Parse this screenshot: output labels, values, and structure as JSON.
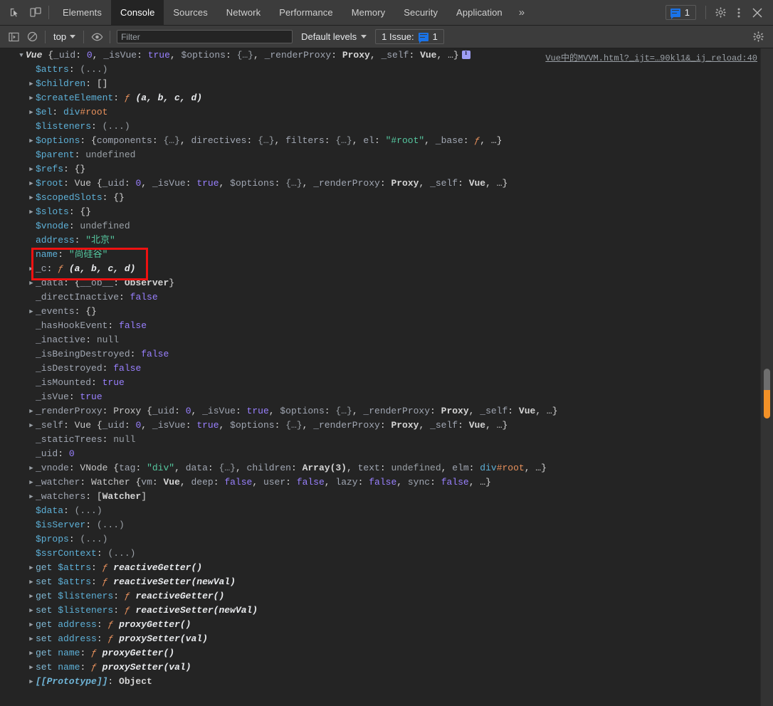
{
  "window": {
    "title": "Chrome DevTools - Console"
  },
  "tabbar": {
    "inspect_icon": "inspect-cursor-icon",
    "device_icon": "device-toggle-icon",
    "tabs": [
      {
        "label": "Elements",
        "active": false
      },
      {
        "label": "Console",
        "active": true
      },
      {
        "label": "Sources",
        "active": false
      },
      {
        "label": "Network",
        "active": false
      },
      {
        "label": "Performance",
        "active": false
      },
      {
        "label": "Memory",
        "active": false
      },
      {
        "label": "Security",
        "active": false
      },
      {
        "label": "Application",
        "active": false
      }
    ],
    "more_label": "»",
    "issue_count": "1",
    "settings_icon": "gear-icon",
    "menu_icon": "kebab-menu-icon",
    "close_icon": "close-icon"
  },
  "filterbar": {
    "sidebar_icon": "show-console-sidebar-icon",
    "clear_icon": "clear-console-icon",
    "context_label": "top",
    "eye_icon": "live-expression-icon",
    "filter_placeholder": "Filter",
    "filter_value": "",
    "levels_label": "Default levels",
    "issues_label": "1 Issue:",
    "issues_count": "1",
    "settings_icon": "console-settings-gear-icon"
  },
  "console": {
    "source_link": "Vue中的MVVM.html?_ijt=…90kl1&_ij_reload:40",
    "annotation": {
      "type": "red-rectangle-highlight",
      "color": "#ee1111",
      "highlighted_rows": [
        "address: \"北京\"",
        "name: \"尚硅谷\""
      ]
    },
    "rows": [
      {
        "arrow": "down",
        "indent": 0,
        "html": "<span class=\"v-ctor\">Vue</span> <span class=\"v-obj\">{</span><span class=\"k-int\">_uid</span><span class=\"v-obj\">: </span><span class=\"v-num\">0</span><span class=\"v-obj\">, </span><span class=\"k-int\">_isVue</span><span class=\"v-obj\">: </span><span class=\"v-bool\">true</span><span class=\"v-obj\">, </span><span class=\"k-int\">$options</span><span class=\"v-obj\">: </span><span class=\"v-dim\">{…}</span><span class=\"v-obj\">, </span><span class=\"k-int\">_renderProxy</span><span class=\"v-obj\">: </span><span class=\"v-bold\">Proxy</span><span class=\"v-obj\">, </span><span class=\"k-int\">_self</span><span class=\"v-obj\">: </span><span class=\"v-bold\">Vue</span><span class=\"v-obj\">, …}</span><span class=\"infoicon\"></span>"
      },
      {
        "arrow": "none",
        "indent": 1,
        "html": "<span class=\"k-name\">$attrs</span><span class=\"v-obj\">: </span><span class=\"v-dim\">(...)</span>"
      },
      {
        "arrow": "right",
        "indent": 1,
        "html": "<span class=\"k-name\">$children</span><span class=\"v-obj\">: </span><span class=\"v-obj\">[]</span>"
      },
      {
        "arrow": "right",
        "indent": 1,
        "html": "<span class=\"k-name\">$createElement</span><span class=\"v-obj\">: </span><span class=\"fnsym\">ƒ</span> <span class=\"v-fn\">(a, b, c, d)</span>"
      },
      {
        "arrow": "right",
        "indent": 1,
        "html": "<span class=\"k-name\">$el</span><span class=\"v-obj\">: </span><span class=\"v-tag\">div</span><span class=\"v-id\">#root</span>"
      },
      {
        "arrow": "none",
        "indent": 1,
        "html": "<span class=\"k-name\">$listeners</span><span class=\"v-obj\">: </span><span class=\"v-dim\">(...)</span>"
      },
      {
        "arrow": "right",
        "indent": 1,
        "html": "<span class=\"k-name\">$options</span><span class=\"v-obj\">: {</span><span class=\"v-prop\">components</span><span class=\"v-obj\">: </span><span class=\"v-dim\">{…}</span><span class=\"v-obj\">, </span><span class=\"v-prop\">directives</span><span class=\"v-obj\">: </span><span class=\"v-dim\">{…}</span><span class=\"v-obj\">, </span><span class=\"v-prop\">filters</span><span class=\"v-obj\">: </span><span class=\"v-dim\">{…}</span><span class=\"v-obj\">, </span><span class=\"v-prop\">el</span><span class=\"v-obj\">: </span><span class=\"v-str\">\"#root\"</span><span class=\"v-obj\">, </span><span class=\"v-prop\">_base</span><span class=\"v-obj\">: </span><span class=\"fnsym\">ƒ</span><span class=\"v-obj\">, …}</span>"
      },
      {
        "arrow": "none",
        "indent": 1,
        "html": "<span class=\"k-name\">$parent</span><span class=\"v-obj\">: </span><span class=\"v-null\">undefined</span>"
      },
      {
        "arrow": "right",
        "indent": 1,
        "html": "<span class=\"k-name\">$refs</span><span class=\"v-obj\">: {}</span>"
      },
      {
        "arrow": "right",
        "indent": 1,
        "html": "<span class=\"k-name\">$root</span><span class=\"v-obj\">: </span><span class=\"v-ctor2\">Vue</span> <span class=\"v-obj\">{</span><span class=\"k-int\">_uid</span><span class=\"v-obj\">: </span><span class=\"v-num\">0</span><span class=\"v-obj\">, </span><span class=\"k-int\">_isVue</span><span class=\"v-obj\">: </span><span class=\"v-bool\">true</span><span class=\"v-obj\">, </span><span class=\"k-int\">$options</span><span class=\"v-obj\">: </span><span class=\"v-dim\">{…}</span><span class=\"v-obj\">, </span><span class=\"k-int\">_renderProxy</span><span class=\"v-obj\">: </span><span class=\"v-bold\">Proxy</span><span class=\"v-obj\">, </span><span class=\"k-int\">_self</span><span class=\"v-obj\">: </span><span class=\"v-bold\">Vue</span><span class=\"v-obj\">, …}</span>"
      },
      {
        "arrow": "right",
        "indent": 1,
        "html": "<span class=\"k-name\">$scopedSlots</span><span class=\"v-obj\">: {}</span>"
      },
      {
        "arrow": "right",
        "indent": 1,
        "html": "<span class=\"k-name\">$slots</span><span class=\"v-obj\">: {}</span>"
      },
      {
        "arrow": "none",
        "indent": 1,
        "html": "<span class=\"k-name\">$vnode</span><span class=\"v-obj\">: </span><span class=\"v-null\">undefined</span>"
      },
      {
        "arrow": "none",
        "indent": 1,
        "html": "<span class=\"k-name\">address</span><span class=\"v-obj\">: </span><span class=\"v-str\">\"北京\"</span>"
      },
      {
        "arrow": "none",
        "indent": 1,
        "html": "<span class=\"k-name\">name</span><span class=\"v-obj\">: </span><span class=\"v-str\">\"尚硅谷\"</span>"
      },
      {
        "arrow": "right",
        "indent": 1,
        "html": "<span class=\"k-int\">_c</span><span class=\"v-obj\">: </span><span class=\"fnsym\">ƒ</span> <span class=\"v-fn\">(a, b, c, d)</span>"
      },
      {
        "arrow": "right",
        "indent": 1,
        "html": "<span class=\"k-int\">_data</span><span class=\"v-obj\">: {</span><span class=\"v-prop\">__ob__</span><span class=\"v-obj\">: </span><span class=\"v-bold\">Observer</span><span class=\"v-obj\">}</span>"
      },
      {
        "arrow": "none",
        "indent": 1,
        "html": "<span class=\"k-int\">_directInactive</span><span class=\"v-obj\">: </span><span class=\"v-bool\">false</span>"
      },
      {
        "arrow": "right",
        "indent": 1,
        "html": "<span class=\"k-int\">_events</span><span class=\"v-obj\">: {}</span>"
      },
      {
        "arrow": "none",
        "indent": 1,
        "html": "<span class=\"k-int\">_hasHookEvent</span><span class=\"v-obj\">: </span><span class=\"v-bool\">false</span>"
      },
      {
        "arrow": "none",
        "indent": 1,
        "html": "<span class=\"k-int\">_inactive</span><span class=\"v-obj\">: </span><span class=\"v-null\">null</span>"
      },
      {
        "arrow": "none",
        "indent": 1,
        "html": "<span class=\"k-int\">_isBeingDestroyed</span><span class=\"v-obj\">: </span><span class=\"v-bool\">false</span>"
      },
      {
        "arrow": "none",
        "indent": 1,
        "html": "<span class=\"k-int\">_isDestroyed</span><span class=\"v-obj\">: </span><span class=\"v-bool\">false</span>"
      },
      {
        "arrow": "none",
        "indent": 1,
        "html": "<span class=\"k-int\">_isMounted</span><span class=\"v-obj\">: </span><span class=\"v-bool\">true</span>"
      },
      {
        "arrow": "none",
        "indent": 1,
        "html": "<span class=\"k-int\">_isVue</span><span class=\"v-obj\">: </span><span class=\"v-bool\">true</span>"
      },
      {
        "arrow": "right",
        "indent": 1,
        "html": "<span class=\"k-int\">_renderProxy</span><span class=\"v-obj\">: </span><span class=\"v-ctor2\">Proxy</span> <span class=\"v-obj\">{</span><span class=\"k-int\">_uid</span><span class=\"v-obj\">: </span><span class=\"v-num\">0</span><span class=\"v-obj\">, </span><span class=\"k-int\">_isVue</span><span class=\"v-obj\">: </span><span class=\"v-bool\">true</span><span class=\"v-obj\">, </span><span class=\"k-int\">$options</span><span class=\"v-obj\">: </span><span class=\"v-dim\">{…}</span><span class=\"v-obj\">, </span><span class=\"k-int\">_renderProxy</span><span class=\"v-obj\">: </span><span class=\"v-bold\">Proxy</span><span class=\"v-obj\">, </span><span class=\"k-int\">_self</span><span class=\"v-obj\">: </span><span class=\"v-bold\">Vue</span><span class=\"v-obj\">, …}</span>"
      },
      {
        "arrow": "right",
        "indent": 1,
        "html": "<span class=\"k-int\">_self</span><span class=\"v-obj\">: </span><span class=\"v-ctor2\">Vue</span> <span class=\"v-obj\">{</span><span class=\"k-int\">_uid</span><span class=\"v-obj\">: </span><span class=\"v-num\">0</span><span class=\"v-obj\">, </span><span class=\"k-int\">_isVue</span><span class=\"v-obj\">: </span><span class=\"v-bool\">true</span><span class=\"v-obj\">, </span><span class=\"k-int\">$options</span><span class=\"v-obj\">: </span><span class=\"v-dim\">{…}</span><span class=\"v-obj\">, </span><span class=\"k-int\">_renderProxy</span><span class=\"v-obj\">: </span><span class=\"v-bold\">Proxy</span><span class=\"v-obj\">, </span><span class=\"k-int\">_self</span><span class=\"v-obj\">: </span><span class=\"v-bold\">Vue</span><span class=\"v-obj\">, …}</span>"
      },
      {
        "arrow": "none",
        "indent": 1,
        "html": "<span class=\"k-int\">_staticTrees</span><span class=\"v-obj\">: </span><span class=\"v-null\">null</span>"
      },
      {
        "arrow": "none",
        "indent": 1,
        "html": "<span class=\"k-int\">_uid</span><span class=\"v-obj\">: </span><span class=\"v-num\">0</span>"
      },
      {
        "arrow": "right",
        "indent": 1,
        "html": "<span class=\"k-int\">_vnode</span><span class=\"v-obj\">: </span><span class=\"v-ctor2\">VNode</span> <span class=\"v-obj\">{</span><span class=\"v-prop\">tag</span><span class=\"v-obj\">: </span><span class=\"v-str\">\"div\"</span><span class=\"v-obj\">, </span><span class=\"v-prop\">data</span><span class=\"v-obj\">: </span><span class=\"v-dim\">{…}</span><span class=\"v-obj\">, </span><span class=\"v-prop\">children</span><span class=\"v-obj\">: </span><span class=\"v-bold\">Array(3)</span><span class=\"v-obj\">, </span><span class=\"v-prop\">text</span><span class=\"v-obj\">: </span><span class=\"v-null\">undefined</span><span class=\"v-obj\">, </span><span class=\"v-prop\">elm</span><span class=\"v-obj\">: </span><span class=\"v-tag\">div</span><span class=\"v-id\">#root</span><span class=\"v-obj\">, …}</span>"
      },
      {
        "arrow": "right",
        "indent": 1,
        "html": "<span class=\"k-int\">_watcher</span><span class=\"v-obj\">: </span><span class=\"v-ctor2\">Watcher</span> <span class=\"v-obj\">{</span><span class=\"v-prop\">vm</span><span class=\"v-obj\">: </span><span class=\"v-bold\">Vue</span><span class=\"v-obj\">, </span><span class=\"v-prop\">deep</span><span class=\"v-obj\">: </span><span class=\"v-bool\">false</span><span class=\"v-obj\">, </span><span class=\"v-prop\">user</span><span class=\"v-obj\">: </span><span class=\"v-bool\">false</span><span class=\"v-obj\">, </span><span class=\"v-prop\">lazy</span><span class=\"v-obj\">: </span><span class=\"v-bool\">false</span><span class=\"v-obj\">, </span><span class=\"v-prop\">sync</span><span class=\"v-obj\">: </span><span class=\"v-bool\">false</span><span class=\"v-obj\">, …}</span>"
      },
      {
        "arrow": "right",
        "indent": 1,
        "html": "<span class=\"k-int\">_watchers</span><span class=\"v-obj\">: [</span><span class=\"v-bold\">Watcher</span><span class=\"v-obj\">]</span>"
      },
      {
        "arrow": "none",
        "indent": 1,
        "html": "<span class=\"k-name\">$data</span><span class=\"v-obj\">: </span><span class=\"v-dim\">(...)</span>"
      },
      {
        "arrow": "none",
        "indent": 1,
        "html": "<span class=\"k-name\">$isServer</span><span class=\"v-obj\">: </span><span class=\"v-dim\">(...)</span>"
      },
      {
        "arrow": "none",
        "indent": 1,
        "html": "<span class=\"k-name\">$props</span><span class=\"v-obj\">: </span><span class=\"v-dim\">(...)</span>"
      },
      {
        "arrow": "none",
        "indent": 1,
        "html": "<span class=\"k-name\">$ssrContext</span><span class=\"v-obj\">: </span><span class=\"v-dim\">(...)</span>"
      },
      {
        "arrow": "right",
        "indent": 1,
        "html": "<span class=\"gs\">get </span><span class=\"k-name\">$attrs</span><span class=\"v-obj\">: </span><span class=\"fnsym\">ƒ</span> <span class=\"v-fn\">reactiveGetter()</span>"
      },
      {
        "arrow": "right",
        "indent": 1,
        "html": "<span class=\"gs\">set </span><span class=\"k-name\">$attrs</span><span class=\"v-obj\">: </span><span class=\"fnsym\">ƒ</span> <span class=\"v-fn\">reactiveSetter(newVal)</span>"
      },
      {
        "arrow": "right",
        "indent": 1,
        "html": "<span class=\"gs\">get </span><span class=\"k-name\">$listeners</span><span class=\"v-obj\">: </span><span class=\"fnsym\">ƒ</span> <span class=\"v-fn\">reactiveGetter()</span>"
      },
      {
        "arrow": "right",
        "indent": 1,
        "html": "<span class=\"gs\">set </span><span class=\"k-name\">$listeners</span><span class=\"v-obj\">: </span><span class=\"fnsym\">ƒ</span> <span class=\"v-fn\">reactiveSetter(newVal)</span>"
      },
      {
        "arrow": "right",
        "indent": 1,
        "html": "<span class=\"gs\">get </span><span class=\"k-name\">address</span><span class=\"v-obj\">: </span><span class=\"fnsym\">ƒ</span> <span class=\"v-fn\">proxyGetter()</span>"
      },
      {
        "arrow": "right",
        "indent": 1,
        "html": "<span class=\"gs\">set </span><span class=\"k-name\">address</span><span class=\"v-obj\">: </span><span class=\"fnsym\">ƒ</span> <span class=\"v-fn\">proxySetter(val)</span>"
      },
      {
        "arrow": "right",
        "indent": 1,
        "html": "<span class=\"gs\">get </span><span class=\"k-name\">name</span><span class=\"v-obj\">: </span><span class=\"fnsym\">ƒ</span> <span class=\"v-fn\">proxyGetter()</span>"
      },
      {
        "arrow": "right",
        "indent": 1,
        "html": "<span class=\"gs\">set </span><span class=\"k-name\">name</span><span class=\"v-obj\">: </span><span class=\"fnsym\">ƒ</span> <span class=\"v-fn\">proxySetter(val)</span>"
      },
      {
        "arrow": "right",
        "indent": 1,
        "html": "<span class=\"proto\">[[Prototype]]</span><span class=\"v-obj\">: </span><span class=\"v-bold\">Object</span>"
      }
    ]
  },
  "colors": {
    "background": "#242424",
    "toolbar": "#3c3c3c",
    "accent_blue": "#1a73e8",
    "string_green": "#56c8a0",
    "number_purple": "#9980ff",
    "key_blue": "#5db0d7",
    "annotation_red": "#ee1111",
    "scrollbar_orange": "#f29127"
  }
}
